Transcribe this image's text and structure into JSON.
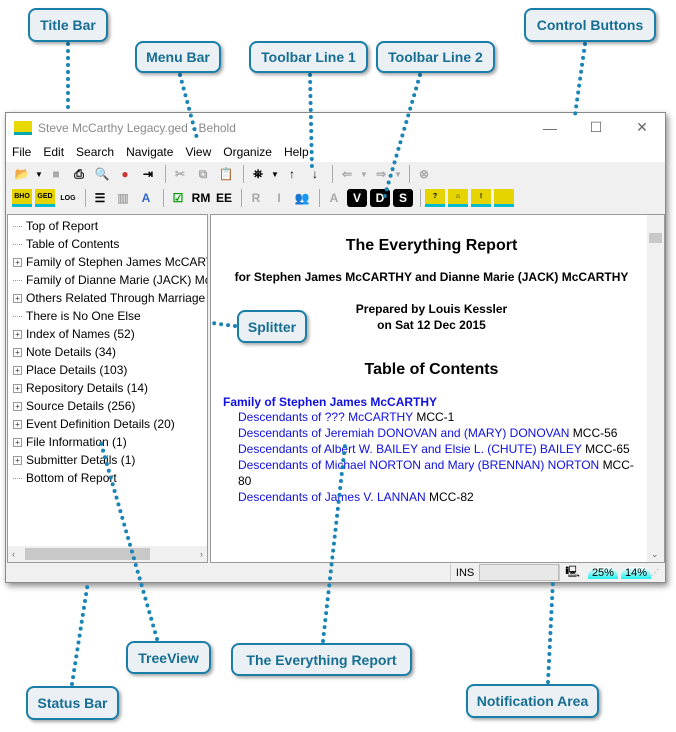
{
  "window": {
    "title": "Steve McCarthy Legacy.ged - Behold",
    "controls": [
      "—",
      "☐",
      "✕"
    ]
  },
  "menu": [
    "File",
    "Edit",
    "Search",
    "Navigate",
    "View",
    "Organize",
    "Help"
  ],
  "toolbar1": {
    "icons": [
      "open-folder-icon",
      "save-icon",
      "print-icon",
      "print-preview-icon",
      "cd-icon",
      "exit-icon",
      "cut-icon",
      "copy-icon",
      "paste-icon",
      "find-icon",
      "find-up-icon",
      "find-down-icon",
      "back-icon",
      "forward-icon",
      "stop-icon"
    ]
  },
  "toolbar2": {
    "icons": [
      "bho-icon",
      "ged-icon",
      "log-icon",
      "layout-icon",
      "columns-icon",
      "font-icon",
      "check-icon",
      "rm-button",
      "ee-button",
      "r-icon",
      "i-icon",
      "people-icon",
      "a-icon",
      "v-icon",
      "d-icon",
      "s-icon",
      "help-behold-icon",
      "home-behold-icon",
      "idea-behold-icon",
      "behold-icon"
    ],
    "labels": {
      "bho": "BHO",
      "ged": "GED",
      "log": "LOG",
      "rm": "RM",
      "ee": "EE",
      "r": "R",
      "i": "I",
      "a": "A",
      "v": "V",
      "d": "D",
      "s": "S"
    }
  },
  "tree": [
    {
      "label": "Top of Report",
      "expandable": false
    },
    {
      "label": "Table of Contents",
      "expandable": false
    },
    {
      "label": "Family of Stephen James McCARTHY",
      "expandable": true
    },
    {
      "label": "Family of Dianne Marie (JACK) McCARTHY",
      "expandable": false
    },
    {
      "label": "Others Related Through Marriage",
      "expandable": true
    },
    {
      "label": "There is No One Else",
      "expandable": false
    },
    {
      "label": "Index of Names (52)",
      "expandable": true
    },
    {
      "label": "Note Details (34)",
      "expandable": true
    },
    {
      "label": "Place Details (103)",
      "expandable": true
    },
    {
      "label": "Repository Details (14)",
      "expandable": true
    },
    {
      "label": "Source Details (256)",
      "expandable": true
    },
    {
      "label": "Event Definition Details (20)",
      "expandable": true
    },
    {
      "label": "File Information (1)",
      "expandable": true
    },
    {
      "label": "Submitter Details (1)",
      "expandable": true
    },
    {
      "label": "Bottom of Report",
      "expandable": false
    }
  ],
  "report": {
    "title": "The Everything Report",
    "for": "for Stephen James McCARTHY and Dianne Marie (JACK) McCARTHY",
    "prepared_by": "Prepared by Louis Kessler",
    "prepared_on": "on Sat 12 Dec 2015",
    "toc_title": "Table of Contents",
    "toc_family": "Family of Stephen James McCARTHY",
    "toc_items": [
      {
        "link": "Descendants of ??? McCARTHY",
        "code": "MCC-1"
      },
      {
        "link": "Descendants of Jeremiah DONOVAN and (MARY) DONOVAN",
        "code": "MCC-56"
      },
      {
        "link": "Descendants of Albert W. BAILEY and Elsie L. (CHUTE) BAILEY",
        "code": "MCC-65"
      },
      {
        "link": "Descendants of Michael NORTON and Mary (BRENNAN) NORTON",
        "code": "MCC-80"
      },
      {
        "link": "Descendants of James V. LANNAN",
        "code": "MCC-82"
      }
    ]
  },
  "status": {
    "mode": "INS",
    "gauge1": "25%",
    "gauge2": "14%"
  },
  "callouts": {
    "title_bar": "Title Bar",
    "menu_bar": "Menu Bar",
    "toolbar1": "Toolbar Line 1",
    "toolbar2": "Toolbar Line 2",
    "control_buttons": "Control Buttons",
    "splitter": "Splitter",
    "treeview": "TreeView",
    "everything_report": "The Everything Report",
    "status_bar": "Status Bar",
    "notification_area": "Notification Area"
  },
  "colors": {
    "callout_border": "#1a7fa8",
    "callout_bg": "#eaf0f4",
    "link": "#1010e0"
  }
}
